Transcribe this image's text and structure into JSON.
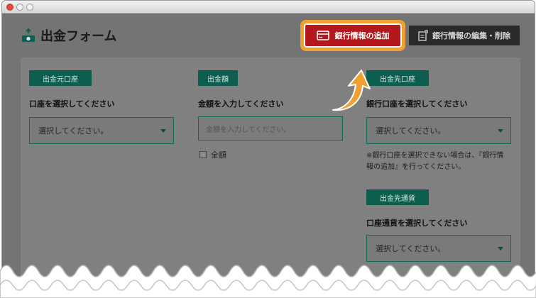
{
  "window": {
    "controls": [
      "close",
      "minimize",
      "zoom"
    ]
  },
  "header": {
    "title": "出金フォーム",
    "icon": "money-bag-icon",
    "add_bank_button": "銀行情報の追加",
    "edit_bank_button": "銀行情報の編集・削除"
  },
  "form": {
    "source_account": {
      "chip": "出金元口座",
      "label": "口座を選択してください",
      "value": "選択してください。"
    },
    "amount": {
      "chip": "出金額",
      "label": "金額を入力してください",
      "placeholder": "金額を入力してください。",
      "full_amount": "全額"
    },
    "destination_account": {
      "chip": "出金先口座",
      "label": "銀行口座を選択してください",
      "value": "選択してください。",
      "note": "※銀行口座を選択できない場合は、『銀行情報の追加』を行ってください。"
    },
    "destination_currency": {
      "chip": "出金先通貨",
      "label": "口座通貨を選択してください",
      "value": "選択してください。"
    }
  },
  "colors": {
    "accent_green": "#0e5e4f",
    "highlight_orange": "#f0a030",
    "add_button_red": "#b3181c"
  }
}
